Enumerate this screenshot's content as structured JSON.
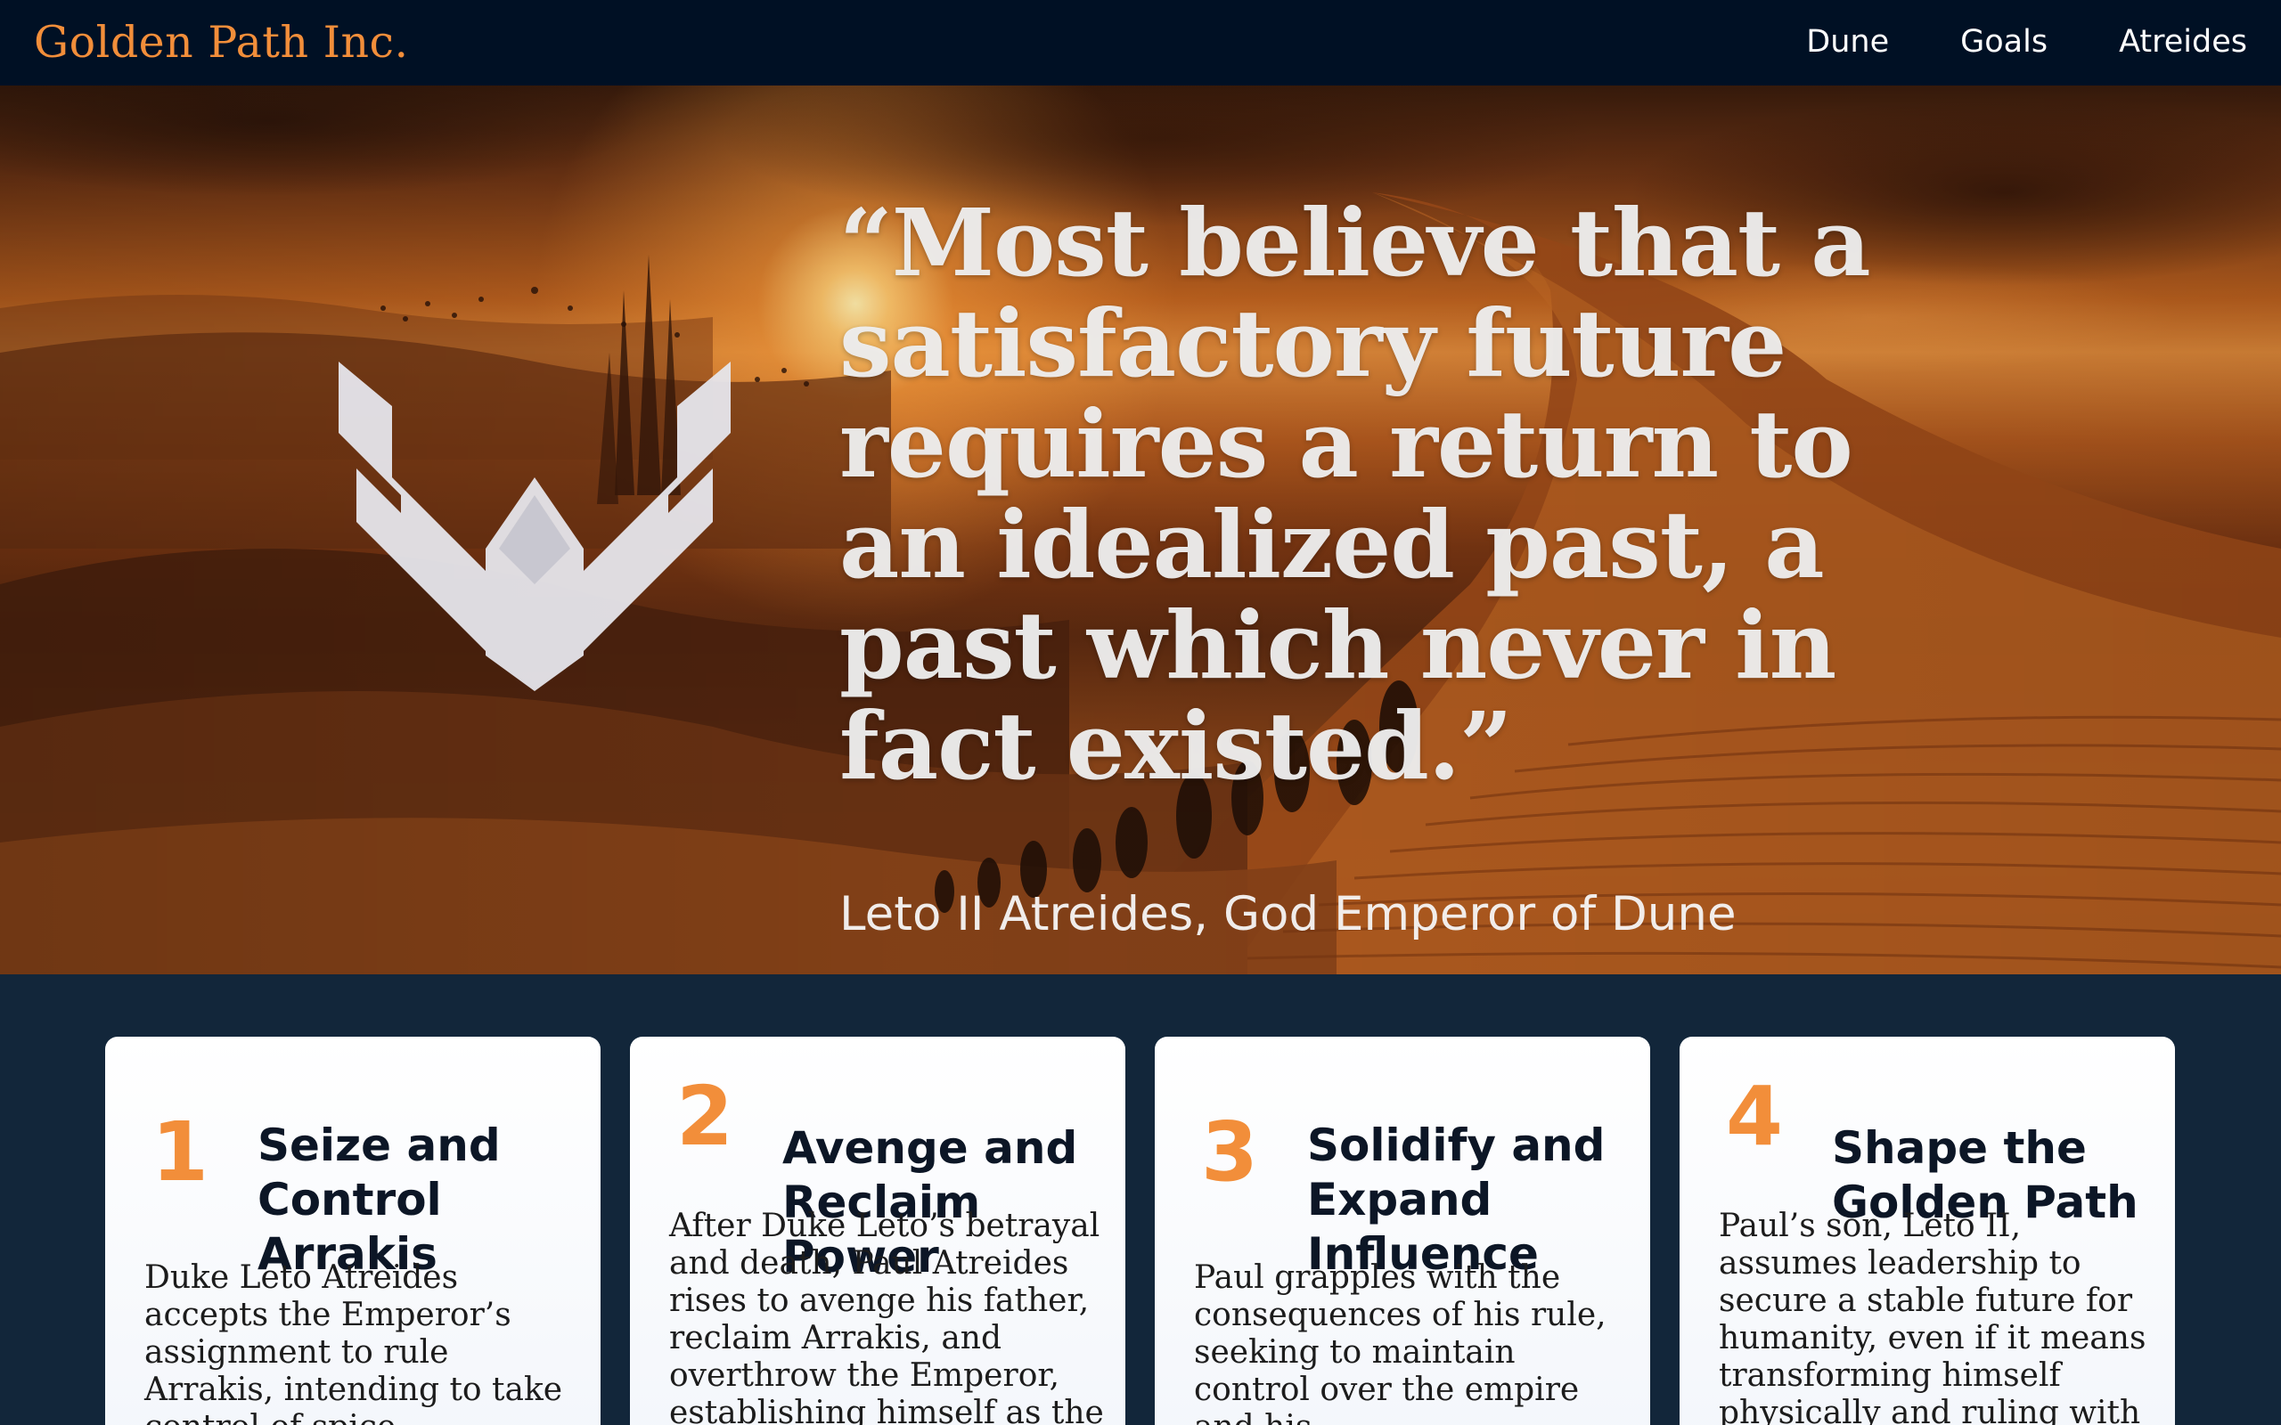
{
  "header": {
    "brand": "Golden Path Inc.",
    "nav": [
      "Dune",
      "Goals",
      "Atreides"
    ]
  },
  "hero": {
    "quote": "“Most believe that a satisfactory future requires a return to an idealized past, a past which never in fact existed.”",
    "attribution": "Leto II Atreides, God Emperor of Dune"
  },
  "goals": [
    {
      "number": "1",
      "title": "Seize and Control Arrakis",
      "description": "Duke Leto Atreides accepts the Emperor’s assignment to rule Arrakis, intending to take control of spice"
    },
    {
      "number": "2",
      "title": "Avenge and Reclaim Power",
      "description": "After Duke Leto’s betrayal and death, Paul Atreides rises to avenge his father, reclaim Arrakis, and overthrow the Emperor, establishing himself as the"
    },
    {
      "number": "3",
      "title": "Solidify and Expand Influence",
      "description": "Paul grapples with the consequences of his rule, seeking to maintain control over the empire and his"
    },
    {
      "number": "4",
      "title": "Shape the Golden Path",
      "description": "Paul’s son, Leto II, assumes leadership to secure a stable future for humanity, even if it means transforming himself physically and ruling with near-absolute power"
    }
  ],
  "colors": {
    "header_bg": "#001024",
    "brand": "#f28e3a",
    "accent_number": "#f28e3a",
    "cards_section_bg": "#12263a",
    "card_bg": "#ffffff"
  },
  "icons": {
    "emblem": "atreides-hawk-emblem-icon"
  }
}
